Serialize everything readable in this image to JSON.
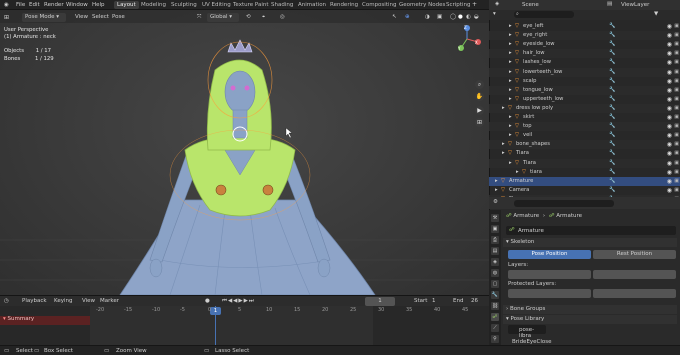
{
  "menu": {
    "items": [
      "File",
      "Edit",
      "Render",
      "Window",
      "Help"
    ]
  },
  "workspaces": [
    "Layout",
    "Modeling",
    "Sculpting",
    "UV Editing",
    "Texture Paint",
    "Shading",
    "Animation",
    "Rendering",
    "Compositing",
    "Geometry Nodes",
    "Scripting"
  ],
  "scene": {
    "name": "Scene",
    "view_layer": "ViewLayer"
  },
  "viewport": {
    "mode": "Pose Mode",
    "menus": [
      "View",
      "Select",
      "Pose"
    ],
    "orientation": "Global",
    "view_name": "User Perspective",
    "active_object": "(1) Armature : neck",
    "stats": [
      {
        "label": "Objects",
        "value": "1 / 17"
      },
      {
        "label": "Bones",
        "value": "1 / 129"
      }
    ],
    "gizmo_axes": {
      "x": "X",
      "y": "Y",
      "z": "Z"
    }
  },
  "outliner": {
    "rows": [
      {
        "label": "eye_left",
        "indent": 2
      },
      {
        "label": "eye_right",
        "indent": 2
      },
      {
        "label": "eyeside_low",
        "indent": 2
      },
      {
        "label": "hair_low",
        "indent": 2
      },
      {
        "label": "lashes_low",
        "indent": 2
      },
      {
        "label": "lowerteeth_low",
        "indent": 2
      },
      {
        "label": "scalp",
        "indent": 2
      },
      {
        "label": "tongue_low",
        "indent": 2
      },
      {
        "label": "upperteeth_low",
        "indent": 2
      },
      {
        "label": "dress low poly",
        "indent": 1
      },
      {
        "label": "skirt",
        "indent": 2
      },
      {
        "label": "top",
        "indent": 2
      },
      {
        "label": "veil",
        "indent": 2
      },
      {
        "label": "bone_shapes",
        "indent": 1
      },
      {
        "label": "Tiara",
        "indent": 1
      },
      {
        "label": "Tiara",
        "indent": 2
      },
      {
        "label": "tiara",
        "indent": 3
      },
      {
        "label": "Armature",
        "indent": 0,
        "selected": true
      },
      {
        "label": "Camera",
        "indent": 0
      },
      {
        "label": "Floor",
        "indent": 0
      }
    ]
  },
  "properties": {
    "breadcrumb": [
      "Armature",
      "Armature"
    ],
    "data_name": "Armature",
    "skeleton_header": "Skeleton",
    "pose_position": "Pose Position",
    "rest_position": "Rest Position",
    "layers_label": "Layers:",
    "protected_label": "Protected Layers:",
    "bone_groups": "Bone Groups",
    "pose_library": "Pose Library",
    "pose_lib_name": "pose-libra",
    "bottom_item": "BrideEyeClose"
  },
  "timeline": {
    "menus": [
      "Playback",
      "Keying",
      "View",
      "Marker"
    ],
    "current_frame": "1",
    "start_label": "Start",
    "start": "1",
    "end_label": "End",
    "end": "26",
    "ticks": [
      "-20",
      "-15",
      "-10",
      "-5",
      "0",
      "1",
      "5",
      "10",
      "15",
      "20",
      "25",
      "30",
      "35",
      "40",
      "45"
    ],
    "track_label": "Summary"
  },
  "status": {
    "items": [
      "Select",
      "Box Select",
      "Zoom View",
      "Lasso Select"
    ]
  },
  "colors": {
    "accent": "#4772b3",
    "selection_orange": "#ff9d3a",
    "bone_green": "#b9e56b",
    "mesh_blue": "#8aa2c6"
  }
}
